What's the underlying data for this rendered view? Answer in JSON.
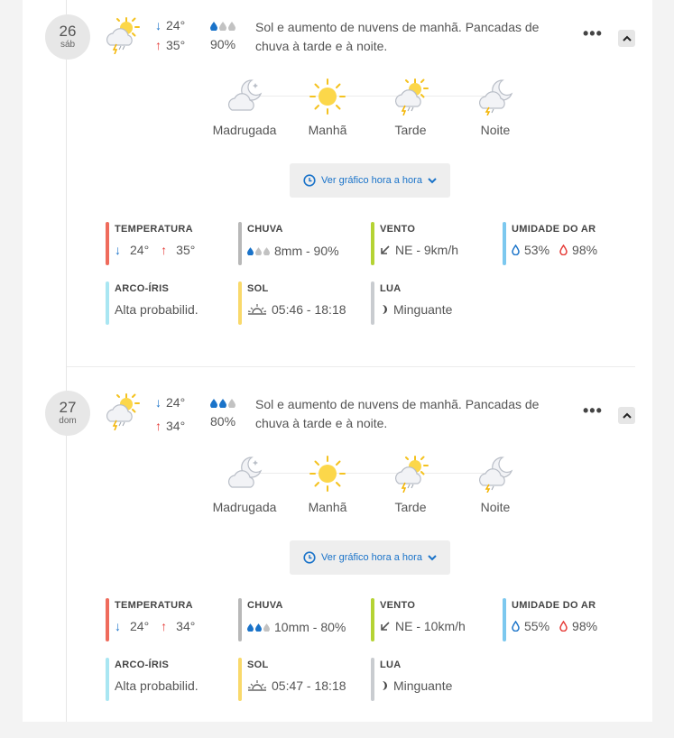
{
  "days": [
    {
      "date": "26",
      "weekday": "sáb",
      "main_icon": "sun-cloud-storm-icon",
      "temp_min": "24°",
      "temp_max": "35°",
      "rain_prob": "90%",
      "rain_drops_filled": 1,
      "summary": "Sol e aumento de nuvens de manhã. Pancadas de chuva à tarde e à noite.",
      "periods": [
        {
          "label": "Madrugada",
          "icon": "moon-cloud-icon"
        },
        {
          "label": "Manhã",
          "icon": "sun-icon"
        },
        {
          "label": "Tarde",
          "icon": "sun-cloud-storm-icon"
        },
        {
          "label": "Noite",
          "icon": "moon-cloud-storm-icon"
        }
      ],
      "hourly_label": "Ver gráfico hora a hora",
      "stats": {
        "temperatura": {
          "title": "TEMPERATURA",
          "min": "24°",
          "max": "35°"
        },
        "chuva": {
          "title": "CHUVA",
          "value": "8mm - 90%"
        },
        "vento": {
          "title": "VENTO",
          "value": "NE - 9km/h"
        },
        "umidade": {
          "title": "UMIDADE DO AR",
          "min": "53%",
          "max": "98%"
        },
        "arco_iris": {
          "title": "ARCO-ÍRIS",
          "value": "Alta probabilid."
        },
        "sol": {
          "title": "SOL",
          "value": "05:46 - 18:18"
        },
        "lua": {
          "title": "LUA",
          "value": "Minguante"
        }
      }
    },
    {
      "date": "27",
      "weekday": "dom",
      "main_icon": "sun-cloud-storm-icon",
      "temp_min": "24°",
      "temp_max": "34°",
      "rain_prob": "80%",
      "rain_drops_filled": 2,
      "summary": "Sol e aumento de nuvens de manhã. Pancadas de chuva à tarde e à noite.",
      "periods": [
        {
          "label": "Madrugada",
          "icon": "moon-cloud-icon"
        },
        {
          "label": "Manhã",
          "icon": "sun-icon"
        },
        {
          "label": "Tarde",
          "icon": "sun-cloud-storm-icon"
        },
        {
          "label": "Noite",
          "icon": "moon-cloud-storm-icon"
        }
      ],
      "hourly_label": "Ver gráfico hora a hora",
      "stats": {
        "temperatura": {
          "title": "TEMPERATURA",
          "min": "24°",
          "max": "34°"
        },
        "chuva": {
          "title": "CHUVA",
          "value": "10mm - 80%"
        },
        "vento": {
          "title": "VENTO",
          "value": "NE - 10km/h"
        },
        "umidade": {
          "title": "UMIDADE DO AR",
          "min": "55%",
          "max": "98%"
        },
        "arco_iris": {
          "title": "ARCO-ÍRIS",
          "value": "Alta probabilid."
        },
        "sol": {
          "title": "SOL",
          "value": "05:47 - 18:18"
        },
        "lua": {
          "title": "LUA",
          "value": "Minguante"
        }
      }
    }
  ],
  "colors": {
    "temperatura": "#ef6b5c",
    "chuva": "#b8b8b8",
    "vento": "#b5d334",
    "umidade": "#7cc8ef",
    "arco_iris": "#a9e6f2",
    "sol": "#f9d96b",
    "lua": "#c9ccd0",
    "accent_blue": "#1a73c9",
    "accent_red": "#e53935"
  }
}
